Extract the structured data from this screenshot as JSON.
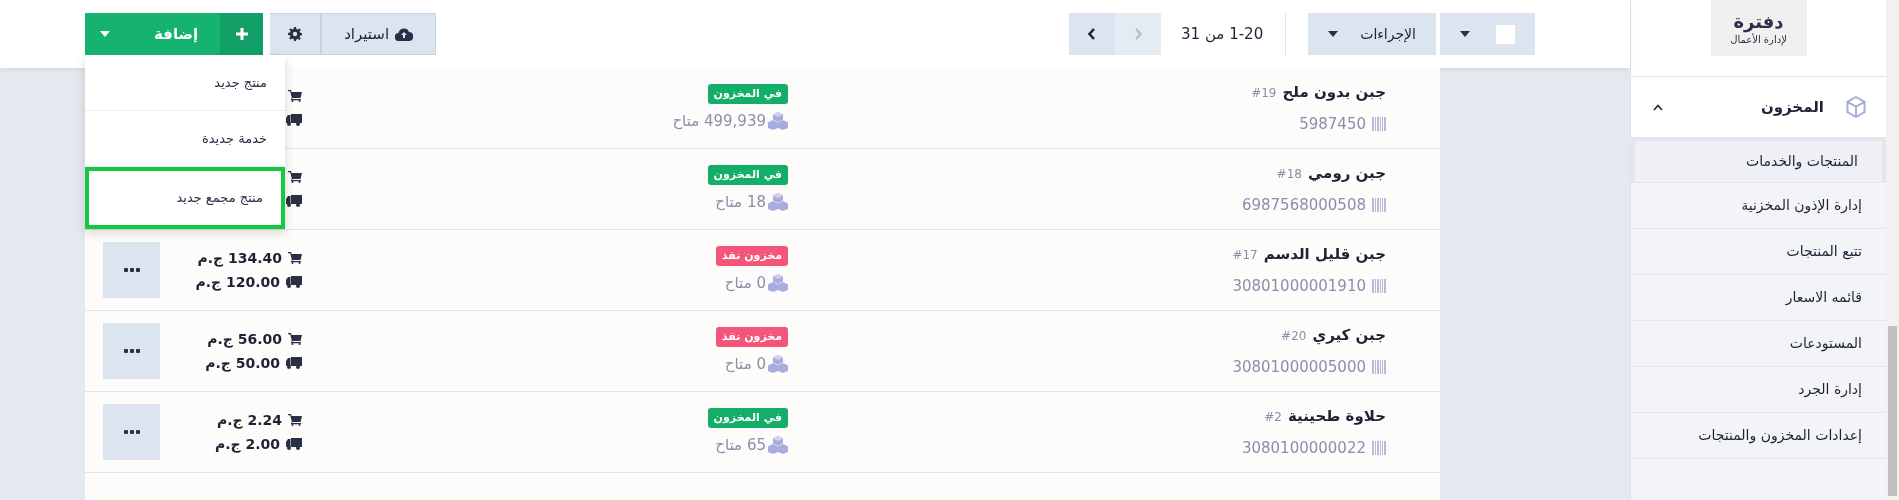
{
  "logo": {
    "name": "دفترة",
    "tagline": "لإدارة الأعمال"
  },
  "toolbar": {
    "add_button": "إضافة",
    "import_button": "استيراد",
    "actions_button": "الإجراءات",
    "select_all": {
      "checked": false
    },
    "pagination": {
      "text": "1-20 من 31",
      "prev_disabled": true,
      "next_disabled": false
    },
    "add_menu": [
      {
        "label": "منتج جديد",
        "highlighted": false
      },
      {
        "label": "خدمة جديدة",
        "highlighted": false
      },
      {
        "label": "منتج مجمع جديد",
        "highlighted": true
      }
    ]
  },
  "sidebar": {
    "section": {
      "label": "المخزون",
      "expanded": true
    },
    "items": [
      {
        "label": "المنتجات والخدمات",
        "highlighted": true
      },
      {
        "label": "إدارة الإذون المخزنية",
        "highlighted": false
      },
      {
        "label": "تتبع المنتجات",
        "highlighted": false
      },
      {
        "label": "قائمه الاسعار",
        "highlighted": false
      },
      {
        "label": "المستودعات",
        "highlighted": false
      },
      {
        "label": "إدارة الجرد",
        "highlighted": false
      },
      {
        "label": "إعدادات المخزون والمنتجات",
        "highlighted": false
      }
    ]
  },
  "products": [
    {
      "name": "جبن بدون ملح",
      "number": "#19",
      "barcode": "5987450",
      "status": {
        "kind": "in_stock",
        "label": "في المخزون"
      },
      "available": "499,939 متاح"
    },
    {
      "name": "جبن رومي",
      "number": "#18",
      "barcode": "6987568000508",
      "status": {
        "kind": "in_stock",
        "label": "في المخزون"
      },
      "available": "18 متاح"
    },
    {
      "name": "جبن قليل الدسم",
      "number": "#17",
      "barcode": "30801000001910",
      "status": {
        "kind": "out_of_stock",
        "label": "مخزون نفذ"
      },
      "available": "0 متاح",
      "sell_price": "134.40 ج.م",
      "buy_price": "120.00 ج.م"
    },
    {
      "name": "جبن كيري",
      "number": "#20",
      "barcode": "30801000005000",
      "status": {
        "kind": "out_of_stock",
        "label": "مخزون نفذ"
      },
      "available": "0 متاح",
      "sell_price": "56.00 ج.م",
      "buy_price": "50.00 ج.م"
    },
    {
      "name": "حلاوة طحينية",
      "number": "#2",
      "barcode": "3080100000022",
      "status": {
        "kind": "in_stock",
        "label": "في المخزون"
      },
      "available": "65 متاح",
      "sell_price": "2.24 ج.م",
      "buy_price": "2.00 ج.م"
    }
  ]
}
